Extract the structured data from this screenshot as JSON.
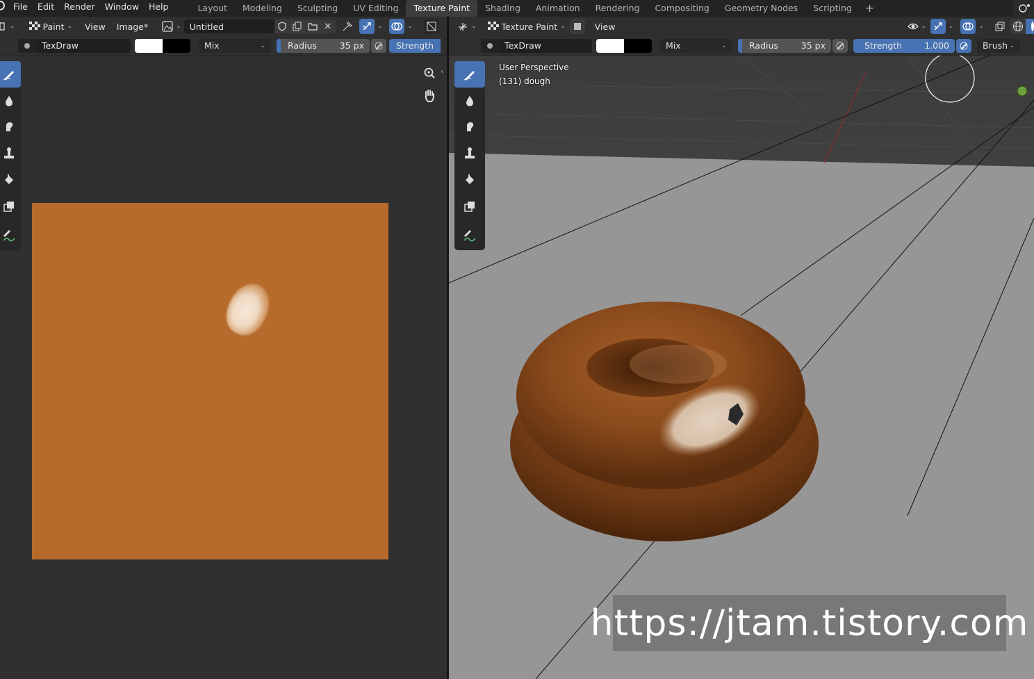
{
  "menu": {
    "items": [
      "File",
      "Edit",
      "Render",
      "Window",
      "Help"
    ]
  },
  "workspaces": {
    "tabs": [
      "Layout",
      "Modeling",
      "Sculpting",
      "UV Editing",
      "Texture Paint",
      "Shading",
      "Animation",
      "Rendering",
      "Compositing",
      "Geometry Nodes",
      "Scripting"
    ],
    "active": "Texture Paint",
    "add_symbol": "+"
  },
  "image_editor": {
    "mode_label": "Paint",
    "view_label": "View",
    "image_menu_label": "Image*",
    "image_name": "Untitled",
    "brush_name": "TexDraw",
    "blend_mode": "Mix",
    "radius_label": "Radius",
    "radius_value": "35 px",
    "strength_label": "Strength",
    "texture_color": "#b66a2b"
  },
  "viewport": {
    "mode_label": "Texture Paint",
    "view_label": "View",
    "brush_name": "TexDraw",
    "blend_mode": "Mix",
    "radius_label": "Radius",
    "radius_value": "35 px",
    "strength_label": "Strength",
    "strength_value": "1.000",
    "brush_menu_label": "Brush",
    "perspective_label": "User Perspective",
    "object_label": "(131) dough"
  },
  "watermark": {
    "text": "https://jtam.tistory.com"
  },
  "colors": {
    "accent": "#4772b3",
    "dough": "#8a4a1c",
    "floor": "#969696"
  }
}
